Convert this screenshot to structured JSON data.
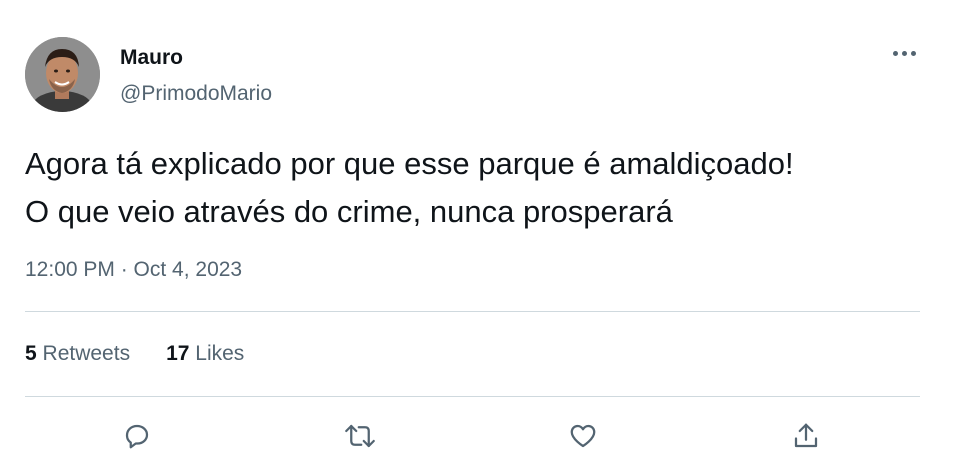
{
  "user": {
    "display_name": "Mauro",
    "handle": "@PrimodoMario",
    "avatar_icon": "avatar-photo"
  },
  "menu": {
    "icon": "more-horizontal-icon"
  },
  "tweet": {
    "lines": [
      "Agora tá explicado por que esse parque é amaldiçoado!",
      "O que veio através do crime, nunca prosperará"
    ],
    "timestamp": "12:00 PM · Oct 4, 2023"
  },
  "stats": {
    "retweets_count": "5",
    "retweets_label": "Retweets",
    "likes_count": "17",
    "likes_label": "Likes"
  },
  "actions": [
    "reply-icon",
    "retweet-icon",
    "like-icon",
    "share-icon"
  ],
  "colors": {
    "text_primary": "#0f1419",
    "text_secondary": "#536471",
    "divider": "#cfd9de"
  }
}
